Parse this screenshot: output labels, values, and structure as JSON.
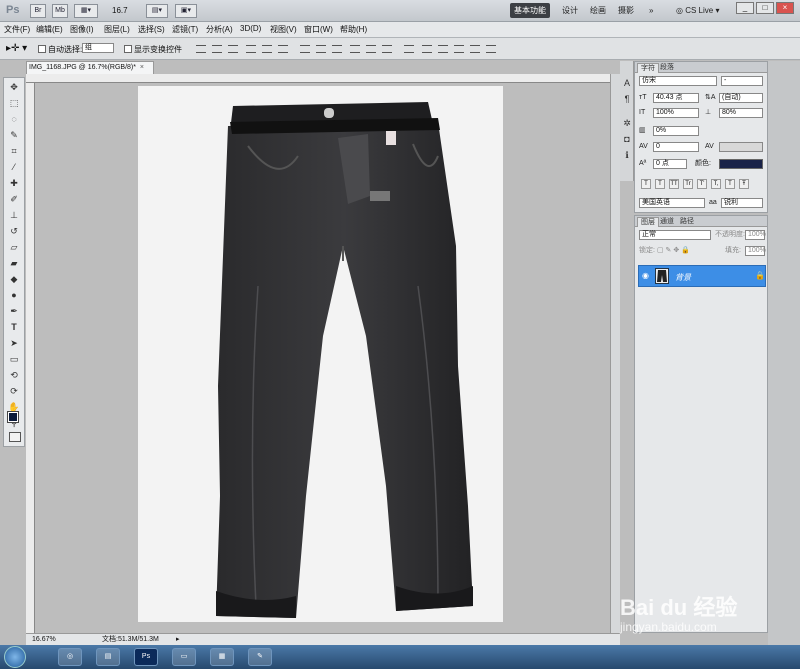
{
  "titlebar": {
    "logo": "Ps",
    "br_icon": "Br",
    "mb_icon": "Mb",
    "zoom_value": "16.7",
    "workspaces": [
      "基本功能",
      "设计",
      "绘画",
      "摄影"
    ],
    "more": "»",
    "cslive": "CS Live",
    "win_buttons": [
      "_",
      "□",
      "×"
    ]
  },
  "menu": [
    "文件(F)",
    "编辑(E)",
    "图像(I)",
    "图层(L)",
    "选择(S)",
    "滤镜(T)",
    "分析(A)",
    "3D(D)",
    "视图(V)",
    "窗口(W)",
    "帮助(H)"
  ],
  "options": {
    "auto_select_label": "自动选择:",
    "auto_select_value": "组",
    "show_transform_label": "显示变换控件"
  },
  "document": {
    "tab_label": "IMG_1168.JPG @ 16.7%(RGB/8)*",
    "zoom": "16.67%",
    "doc_size": "文档:51.3M/51.3M"
  },
  "toolbar_icons": [
    "move-icon",
    "marquee-icon",
    "lasso-icon",
    "quick-select-icon",
    "crop-icon",
    "eyedropper-icon",
    "healing-icon",
    "brush-icon",
    "stamp-icon",
    "history-brush-icon",
    "eraser-icon",
    "gradient-icon",
    "blur-icon",
    "dodge-icon",
    "pen-icon",
    "type-icon",
    "path-select-icon",
    "shape-icon",
    "3d-rotate-icon",
    "3d-camera-icon",
    "hand-icon",
    "zoom-icon"
  ],
  "character_panel": {
    "tabs": [
      "字符",
      "段落"
    ],
    "font_family": "仿宋",
    "font_style": "-",
    "font_size": "40.43 点",
    "leading": "(自动)",
    "vscale": "100%",
    "hscale": "80%",
    "tracking_a": "0%",
    "tracking_b": "0",
    "baseline": "0 点",
    "color_label": "颜色:",
    "text_color": "#1a2348",
    "style_buttons": [
      "T",
      "T",
      "TT",
      "Tr",
      "T'",
      "T,",
      "T",
      "Ŧ"
    ],
    "language": "美国英语",
    "aa_prefix": "aa",
    "antialias": "锐利"
  },
  "layers_panel": {
    "tabs": [
      "图层",
      "通道",
      "路径"
    ],
    "blend_mode": "正常",
    "opacity_label": "不透明度:",
    "opacity": "100%",
    "lock_label": "锁定:",
    "fill_label": "填充:",
    "fill": "100%",
    "layer_name": "背景"
  },
  "watermark": {
    "brand": "Bai du 经验",
    "url": "jingyan.baidu.com"
  },
  "taskbar": {
    "items": [
      "start-orb-icon",
      "browser-icon",
      "explorer-icon",
      "photoshop-icon",
      "folder-icon",
      "image-viewer-icon",
      "paint-icon"
    ]
  }
}
